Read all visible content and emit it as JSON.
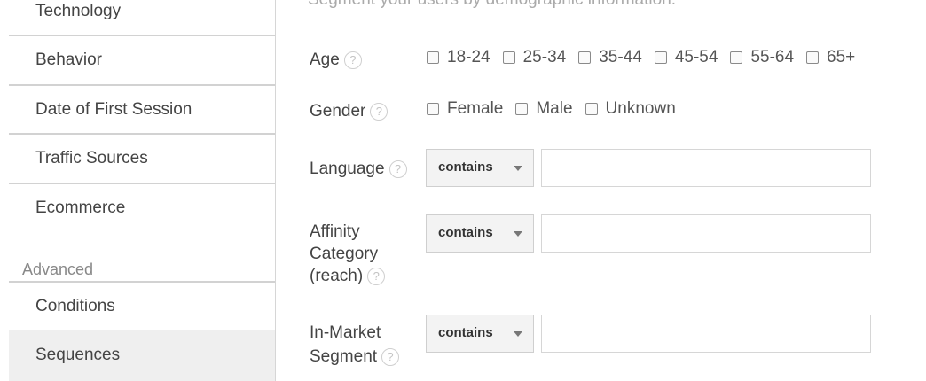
{
  "sidebar": {
    "items": [
      {
        "label": "Technology"
      },
      {
        "label": "Behavior"
      },
      {
        "label": "Date of First Session"
      },
      {
        "label": "Traffic Sources"
      },
      {
        "label": "Ecommerce"
      }
    ],
    "section_label": "Advanced",
    "advanced_items": [
      {
        "label": "Conditions"
      },
      {
        "label": "Sequences"
      }
    ]
  },
  "main": {
    "subtitle": "Segment your users by demographic information.",
    "help_glyph": "?",
    "age": {
      "label": "Age",
      "options": [
        "18-24",
        "25-34",
        "35-44",
        "45-54",
        "55-64",
        "65+"
      ]
    },
    "gender": {
      "label": "Gender",
      "options": [
        "Female",
        "Male",
        "Unknown"
      ]
    },
    "language": {
      "label": "Language",
      "operator": "contains",
      "value": ""
    },
    "affinity": {
      "label_line1": "Affinity",
      "label_line2": "Category",
      "label_line3": "(reach)",
      "operator": "contains",
      "value": ""
    },
    "in_market": {
      "label_line1": "In-Market",
      "label_line2": "Segment",
      "operator": "contains",
      "value": ""
    }
  }
}
